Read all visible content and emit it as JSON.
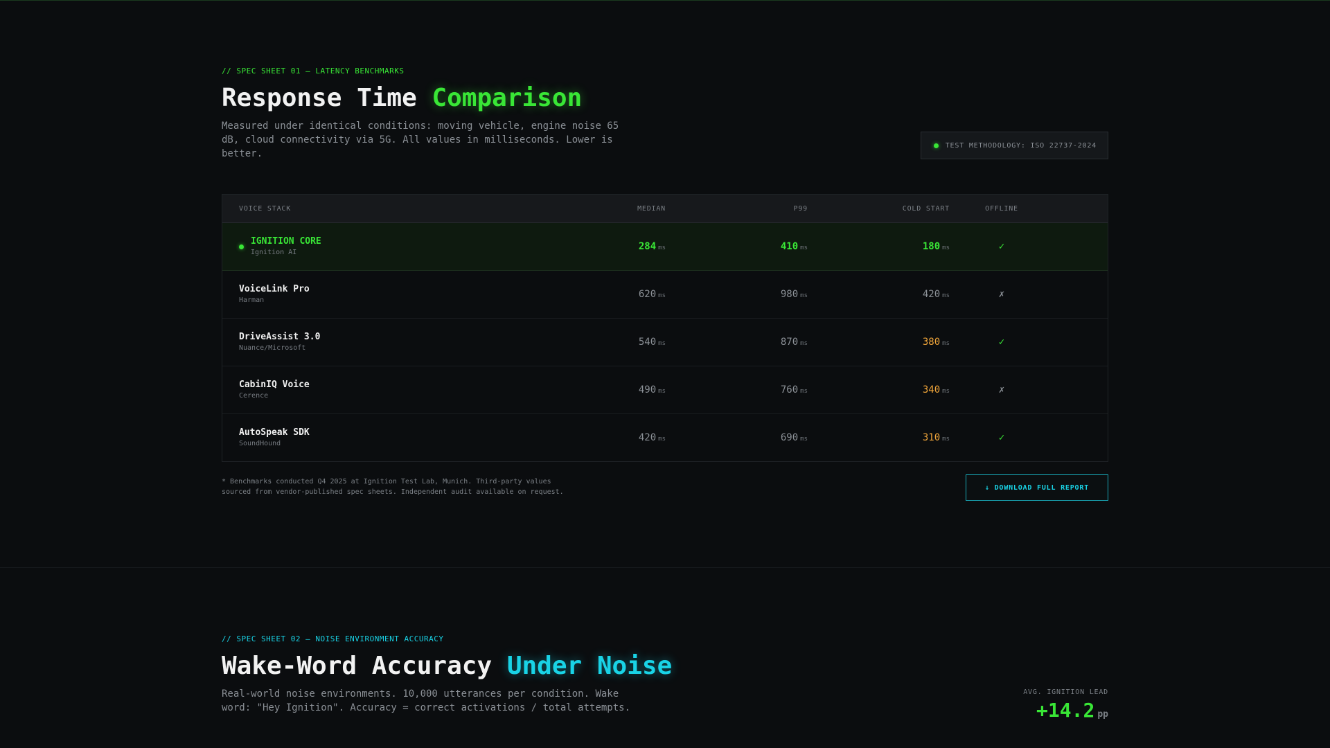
{
  "sheet1": {
    "eyebrow": "// SPEC SHEET 01 — LATENCY BENCHMARKS",
    "title_main": "Response Time",
    "title_accent": "Comparison",
    "description": "Measured under identical conditions: moving vehicle, engine noise 65 dB, cloud connectivity via 5G. All values in milliseconds. Lower is better.",
    "methodology_badge": "TEST METHODOLOGY: ISO 22737-2024",
    "columns": {
      "stack": "VOICE STACK",
      "median": "MEDIAN",
      "p99": "P99",
      "cold_start": "COLD START",
      "offline": "OFFLINE"
    },
    "unit": "ms",
    "rows": [
      {
        "name": "IGNITION CORE",
        "vendor": "Ignition AI",
        "median": "284",
        "p99": "410",
        "cold": "180",
        "offline": "✓"
      },
      {
        "name": "VoiceLink Pro",
        "vendor": "Harman",
        "median": "620",
        "p99": "980",
        "cold": "420",
        "offline": "✗"
      },
      {
        "name": "DriveAssist 3.0",
        "vendor": "Nuance/Microsoft",
        "median": "540",
        "p99": "870",
        "cold": "380",
        "offline": "✓"
      },
      {
        "name": "CabinIQ Voice",
        "vendor": "Cerence",
        "median": "490",
        "p99": "760",
        "cold": "340",
        "offline": "✗"
      },
      {
        "name": "AutoSpeak SDK",
        "vendor": "SoundHound",
        "median": "420",
        "p99": "690",
        "cold": "310",
        "offline": "✓"
      }
    ],
    "footnote_line1": "* Benchmarks conducted Q4 2025 at Ignition Test Lab, Munich. Third-party values",
    "footnote_line2": "sourced from vendor-published spec sheets. Independent audit available on request.",
    "download_label": "↓ DOWNLOAD FULL REPORT"
  },
  "sheet2": {
    "eyebrow": "// SPEC SHEET 02 — NOISE ENVIRONMENT ACCURACY",
    "title_main": "Wake-Word Accuracy",
    "title_accent": "Under Noise",
    "description": "Real-world noise environments. 10,000 utterances per condition. Wake word: \"Hey Ignition\". Accuracy = correct activations / total attempts.",
    "lead_label": "AVG. IGNITION LEAD",
    "lead_value": "+14.2",
    "lead_unit": "pp"
  },
  "colors": {
    "accent_green": "#39e636",
    "accent_cyan": "#19d3e6",
    "accent_orange": "#f0a53a",
    "background": "#0b0d0f"
  }
}
